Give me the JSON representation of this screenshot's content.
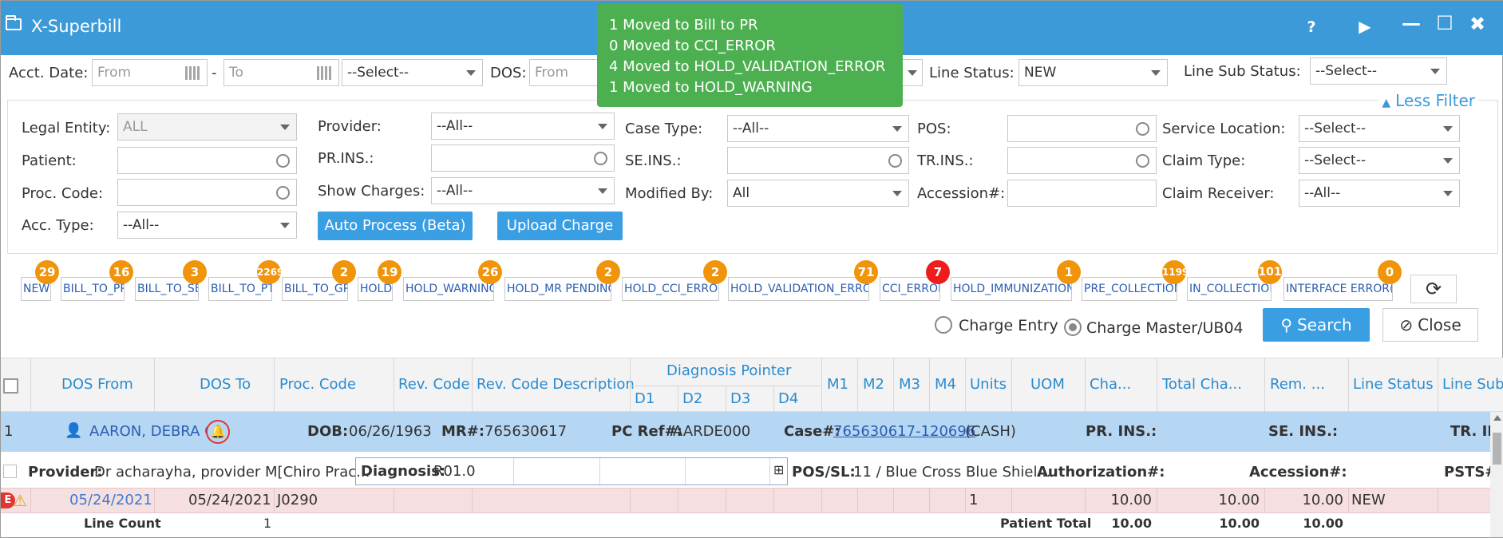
{
  "window": {
    "title": "X-Superbill",
    "help": "?",
    "play": "▶",
    "minimize": "—",
    "maximize": "☐",
    "close": "✖"
  },
  "toast": {
    "lines": [
      "1 Moved to Bill to PR",
      "0 Moved to CCI_ERROR",
      "4 Moved to HOLD_VALIDATION_ERROR",
      "1 Moved to HOLD_WARNING"
    ]
  },
  "filters": {
    "acct_date_label": "Acct. Date:",
    "from_placeholder": "From",
    "dash": "-",
    "to_placeholder": "To",
    "select1": "--Select--",
    "dos_label": "DOS:",
    "dos_from": "From",
    "line_status_label": "Line Status:",
    "line_status_value": "NEW",
    "line_sub_status_label": "Line Sub Status:",
    "line_sub_status_value": "--Select--",
    "less_filter": "Less Filter",
    "legal_entity_label": "Legal Entity:",
    "legal_entity_value": "ALL",
    "provider_label": "Provider:",
    "provider_value": "--All--",
    "case_type_label": "Case Type:",
    "case_type_value": "--All--",
    "pos_label": "POS:",
    "service_location_label": "Service Location:",
    "service_location_value": "--Select--",
    "patient_label": "Patient:",
    "pr_ins_label": "PR.INS.:",
    "se_ins_label": "SE.INS.:",
    "tr_ins_label": "TR.INS.:",
    "claim_type_label": "Claim Type:",
    "claim_type_value": "--Select--",
    "proc_code_label": "Proc. Code:",
    "show_charges_label": "Show Charges:",
    "show_charges_value": "--All--",
    "modified_by_label": "Modified By:",
    "modified_by_value": "All",
    "accession_label": "Accession#:",
    "claim_receiver_label": "Claim Receiver:",
    "claim_receiver_value": "--All--",
    "acc_type_label": "Acc. Type:",
    "acc_type_value": "--All--",
    "auto_process_label": "Auto Process (Beta)",
    "upload_charge_label": "Upload Charge"
  },
  "status_tabs": [
    {
      "label": "NEW",
      "count": "29"
    },
    {
      "label": "BILL_TO_PR",
      "count": "16"
    },
    {
      "label": "BILL_TO_SE",
      "count": "3"
    },
    {
      "label": "BILL_TO_PT",
      "count": "2269"
    },
    {
      "label": "BILL_TO_GR",
      "count": "2"
    },
    {
      "label": "HOLD",
      "count": "19"
    },
    {
      "label": "HOLD_WARNING",
      "count": "26"
    },
    {
      "label": "HOLD_MR PENDING",
      "count": "2"
    },
    {
      "label": "HOLD_CCI_ERROR",
      "count": "2"
    },
    {
      "label": "HOLD_VALIDATION_ERROR",
      "count": "71"
    },
    {
      "label": "CCI_ERROR",
      "count": "7"
    },
    {
      "label": "HOLD_IMMUNIZATION",
      "count": "1"
    },
    {
      "label": "PRE_COLLECTION",
      "count": "1199"
    },
    {
      "label": "IN_COLLECTION",
      "count": "101"
    },
    {
      "label": "INTERFACE ERROR(S)",
      "count": "0"
    }
  ],
  "mode": {
    "charge_entry": "Charge Entry",
    "charge_master": "Charge Master/UB04",
    "search": "Search",
    "close": "Close"
  },
  "grid": {
    "headers": {
      "dos_from": "DOS From",
      "dos_to": "DOS To",
      "proc_code": "Proc. Code",
      "rev_code": "Rev. Code",
      "rev_code_desc": "Rev. Code Description",
      "diag_pointer": "Diagnosis Pointer",
      "d1": "D1",
      "d2": "D2",
      "d3": "D3",
      "d4": "D4",
      "m1": "M1",
      "m2": "M2",
      "m3": "M3",
      "m4": "M4",
      "units": "Units",
      "uom": "UOM",
      "charges": "Cha...",
      "total_charges": "Total Cha...",
      "rem": "Rem. ...",
      "line_status": "Line Status",
      "line_sub": "Line Sub"
    },
    "patient_row": {
      "num": "1",
      "name": "AARON, DEBRA G",
      "dob_label": "DOB:",
      "dob": "06/26/1963",
      "mr_label": "MR#:",
      "mr": "765630617",
      "pc_label": "PC Ref#:",
      "pc": "AARDE000",
      "case_label": "Case#:",
      "case": "765630617-120696",
      "case_type": "(CASH)",
      "pr_ins": "PR. INS.:",
      "se_ins": "SE. INS.:",
      "tr_ins": "TR. IN"
    },
    "provider_row": {
      "provider_label": "Provider:",
      "provider": "Dr acharayha, provider M[Chiro Prac...",
      "diagnosis_label": "Diagnosis:",
      "diagnosis": "R01.0",
      "plus": "⊞",
      "pos_label": "POS/SL:",
      "pos": "11 / Blue Cross Blue Shiel...",
      "auth_label": "Authorization#:",
      "accession_label": "Accession#:",
      "psts_label": "PSTS#:"
    },
    "line": {
      "dos_from": "05/24/2021",
      "dos_to": "05/24/2021",
      "proc": "J0290",
      "units": "1",
      "charges": "10.00",
      "total": "10.00",
      "rem": "10.00",
      "status": "NEW"
    },
    "summary": {
      "line_count_label": "Line Count",
      "line_count": "1",
      "patient_total_label": "Patient Total",
      "charges": "10.00",
      "total": "10.00",
      "rem": "10.00"
    }
  },
  "colors": {
    "titlebar": "#3c9ad9",
    "toast": "#4cb050",
    "badge": "#f0940a",
    "badge_alert": "#ee1d1d",
    "button": "#3a9ee3",
    "selected_row": "#b6d7f4",
    "error_row": "#f6dfe1"
  }
}
